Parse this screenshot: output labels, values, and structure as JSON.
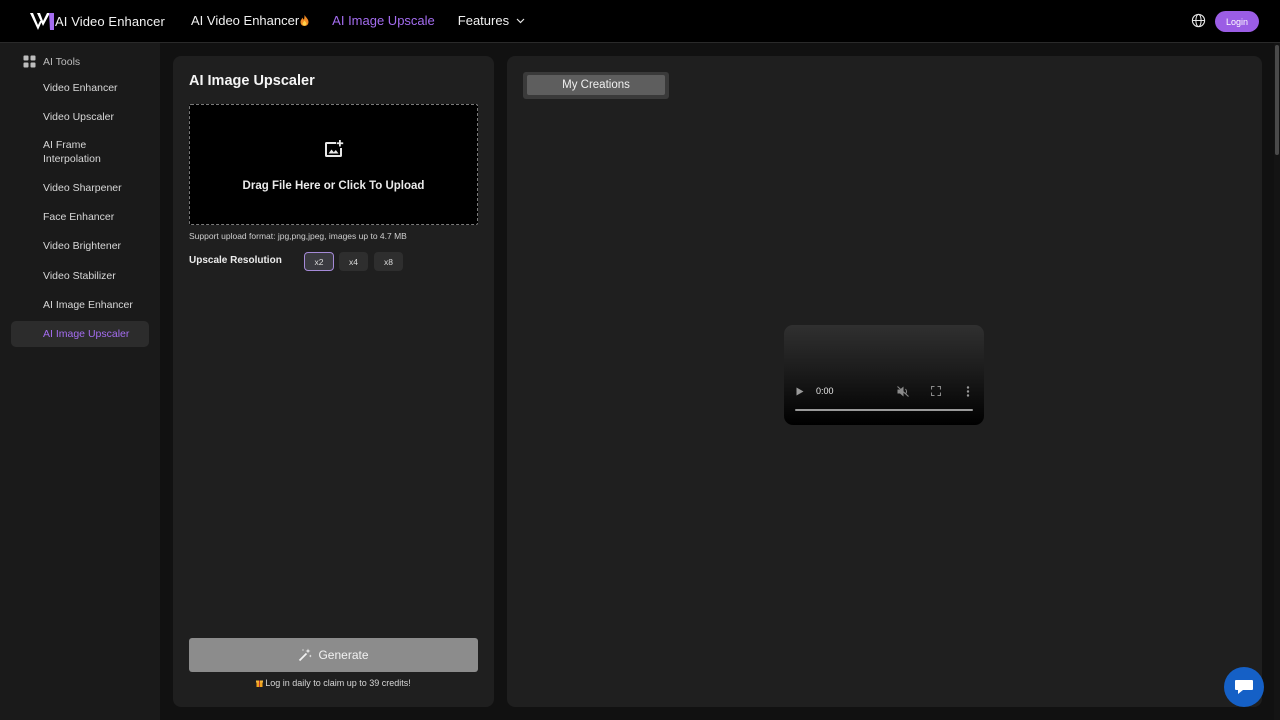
{
  "brand": {
    "name": "AI Video Enhancer",
    "accent": "#a46df0"
  },
  "nav": {
    "items": [
      {
        "label": "AI Video Enhancer",
        "icon": "fire-icon"
      },
      {
        "label": "AI Image Upscale"
      },
      {
        "label": "Features",
        "icon": "chevron-down-icon"
      }
    ]
  },
  "header": {
    "globe_icon": "globe-icon",
    "login_label": "Login"
  },
  "sidebar": {
    "heading": "AI Tools",
    "items": [
      {
        "label": "Video Enhancer"
      },
      {
        "label": "Video Upscaler"
      },
      {
        "label": "AI Frame Interpolation"
      },
      {
        "label": "Video Sharpener"
      },
      {
        "label": "Face Enhancer"
      },
      {
        "label": "Video Brightener"
      },
      {
        "label": "Video Stabilizer"
      },
      {
        "label": "AI Image Enhancer"
      },
      {
        "label": "AI Image Upscaler",
        "active": true
      }
    ]
  },
  "main": {
    "title": "AI Image Upscaler",
    "dropzone_text": "Drag File Here or Click To Upload",
    "support_text": "Support upload format: jpg,png,jpeg, images up to 4.7 MB",
    "resolution_label": "Upscale Resolution",
    "resolutions": [
      "x2",
      "x4",
      "x8"
    ],
    "selected_resolution": "x2",
    "generate_label": "Generate",
    "claim_text": "Log in daily to claim up to 39 credits!"
  },
  "creations": {
    "tab_label": "My Creations",
    "video": {
      "time": "0:00"
    }
  }
}
